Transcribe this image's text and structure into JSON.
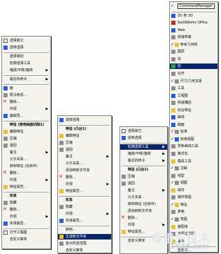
{
  "menu1": {
    "items": [
      {
        "label": "选择其它",
        "icon": "select-other"
      },
      {
        "label": "逆转选择",
        "icon": "invert-selection"
      },
      {
        "label": "选择相切",
        "icon": "none"
      },
      {
        "label": "轮廓选择工具",
        "icon": "none"
      },
      {
        "label": "缩放/平移/旋转",
        "icon": "none",
        "submenu": true
      },
      {
        "label": "最近的命令",
        "icon": "none",
        "submenu": true
      },
      {
        "label": "面",
        "icon": "face"
      },
      {
        "label": "斑马条纹...",
        "icon": "zebra"
      },
      {
        "label": "删除...",
        "icon": "delete"
      },
      {
        "label": "外观",
        "icon": "none",
        "submenu": true
      },
      {
        "label": "面属性...",
        "icon": "face-properties"
      },
      {
        "label": "特征 (使用曲面切除1)",
        "icon": "none",
        "header": true
      },
      {
        "label": "编辑特征",
        "icon": "edit-feature"
      },
      {
        "label": "压缩",
        "icon": "suppress"
      },
      {
        "label": "退回",
        "icon": "rollback"
      },
      {
        "label": "备注",
        "icon": "none",
        "submenu": true
      },
      {
        "label": "父子关系...",
        "icon": "none"
      },
      {
        "label": "转到特征 (在树中)",
        "icon": "none"
      },
      {
        "label": "删除...",
        "icon": "delete"
      },
      {
        "label": "外观",
        "icon": "none",
        "submenu": true
      },
      {
        "label": "特征属性...",
        "icon": "feature-properties"
      },
      {
        "label": "实体",
        "icon": "none",
        "header": true
      },
      {
        "label": "隐藏",
        "icon": "hide"
      },
      {
        "label": "删除...",
        "icon": "delete"
      },
      {
        "label": "外观",
        "icon": "none",
        "submenu": true
      },
      {
        "label": "实体属性...",
        "icon": "body-properties"
      },
      {
        "label": "打开工程图",
        "icon": "open-drawing"
      },
      {
        "label": "自定义菜单",
        "icon": "none"
      }
    ]
  },
  "menu2": {
    "items": [
      {
        "label": "逆转选择",
        "icon": "invert-selection"
      },
      {
        "label": "特征 (凸台1)",
        "icon": "none",
        "header": true
      },
      {
        "label": "编辑特征",
        "icon": "edit-feature"
      },
      {
        "label": "压缩",
        "icon": "suppress"
      },
      {
        "label": "退回",
        "icon": "rollback"
      },
      {
        "label": "备注",
        "icon": "none",
        "submenu": true
      },
      {
        "label": "父子关系...",
        "icon": "none"
      },
      {
        "label": "添加到新文件夹",
        "icon": "none"
      },
      {
        "label": "删除...",
        "icon": "delete"
      },
      {
        "label": "外观",
        "icon": "none",
        "submenu": true
      },
      {
        "label": "特征属性...",
        "icon": "feature-properties"
      },
      {
        "label": "实体",
        "icon": "none",
        "header": true
      },
      {
        "label": "隐藏",
        "icon": "hide"
      },
      {
        "label": "外观",
        "icon": "none",
        "submenu": true
      },
      {
        "label": "实体属性...",
        "icon": "body-properties"
      },
      {
        "label": "转到...",
        "icon": "none"
      },
      {
        "label": "生成新文件夹",
        "icon": "new-folder",
        "highlight": true
      },
      {
        "label": "放大所选范围",
        "icon": "zoom-selection"
      },
      {
        "label": "自定义菜单",
        "icon": "none"
      }
    ]
  },
  "menu3": {
    "items": [
      {
        "label": "选择其它",
        "icon": "select-other"
      },
      {
        "label": "逆转选择",
        "icon": "invert-selection"
      },
      {
        "label": "轮廓选择工具",
        "icon": "none",
        "submenu": true,
        "highlight": true
      },
      {
        "label": "缩放/平移/旋转",
        "icon": "none",
        "submenu": true
      },
      {
        "label": "最近的命令",
        "icon": "none",
        "submenu": true
      },
      {
        "label": "特征 (凸台1)",
        "icon": "none",
        "header": true
      },
      {
        "label": "压缩",
        "icon": "suppress"
      },
      {
        "label": "退回",
        "icon": "rollback"
      },
      {
        "label": "备注",
        "icon": "none",
        "submenu": true
      },
      {
        "label": "父子关系...",
        "icon": "none"
      },
      {
        "label": "转到特征 (在树中)",
        "icon": "none"
      },
      {
        "label": "添加到新文件夹",
        "icon": "none"
      },
      {
        "label": "删除...",
        "icon": "delete"
      },
      {
        "label": "外观",
        "icon": "none",
        "submenu": true
      },
      {
        "label": "特征属性...",
        "icon": "feature-properties"
      },
      {
        "label": "自定义菜单",
        "icon": "none"
      }
    ]
  },
  "menu4": {
    "items": [
      {
        "label": "CommandManager",
        "icon": "none",
        "checked": true,
        "boxed": true
      },
      {
        "label": "2D 到 3D",
        "icon": "2d-to-3d"
      },
      {
        "label": "SolidWorks Office",
        "icon": "solidworks-office"
      },
      {
        "label": "Web",
        "icon": "web"
      },
      {
        "label": "快速草稿",
        "icon": "quick-sketch"
      },
      {
        "label": "参考几何体",
        "icon": "reference-geometry",
        "checked": true
      },
      {
        "label": "图层",
        "icon": "layer"
      },
      {
        "label": "块",
        "icon": "block"
      },
      {
        "label": "宏",
        "icon": "macro",
        "highlight": true
      },
      {
        "label": "对齐",
        "icon": "align"
      },
      {
        "label": "尺寸/几何关系",
        "icon": "dimensions-relations",
        "checked": true
      },
      {
        "label": "工具",
        "icon": "tools"
      },
      {
        "label": "工程图",
        "icon": "drawing"
      },
      {
        "label": "快速捕捉",
        "icon": "quick-snap"
      },
      {
        "label": "扣合特征",
        "icon": "fastening-features"
      },
      {
        "label": "曲线",
        "icon": "curves"
      },
      {
        "label": "曲面",
        "icon": "surfaces"
      },
      {
        "label": "标准",
        "icon": "standard",
        "checked": true
      },
      {
        "label": "标准视图",
        "icon": "standard-views",
        "checked": true
      },
      {
        "label": "样条曲线工具",
        "icon": "spline-tools"
      },
      {
        "label": "格式化",
        "icon": "format"
      },
      {
        "label": "模具工具",
        "icon": "mold-tools"
      },
      {
        "label": "注解",
        "icon": "annotation",
        "checked": true
      },
      {
        "label": "线型",
        "icon": "line-format"
      },
      {
        "label": "视图",
        "icon": "view",
        "checked": true
      },
      {
        "label": "焊件",
        "icon": "weldments"
      },
      {
        "label": "爆炸草图",
        "icon": "explode-sketch"
      },
      {
        "label": "特征",
        "icon": "features",
        "checked": true
      },
      {
        "label": "表格",
        "icon": "table"
      },
      {
        "label": "草图",
        "icon": "sketch",
        "checked": true
      },
      {
        "label": "装配体",
        "icon": "assembly"
      },
      {
        "label": "选择过滤器",
        "icon": "selection-filter"
      },
      {
        "label": "钣金",
        "icon": "sheet-metal"
      },
      {
        "label": "自定义...",
        "icon": "none"
      }
    ]
  },
  "watermark": {
    "text": "有限元技术",
    "site": "1CAE.com"
  },
  "colors": {
    "menu_bg": "#f4f3ee",
    "highlight": "#0a246a",
    "border": "#808080"
  }
}
